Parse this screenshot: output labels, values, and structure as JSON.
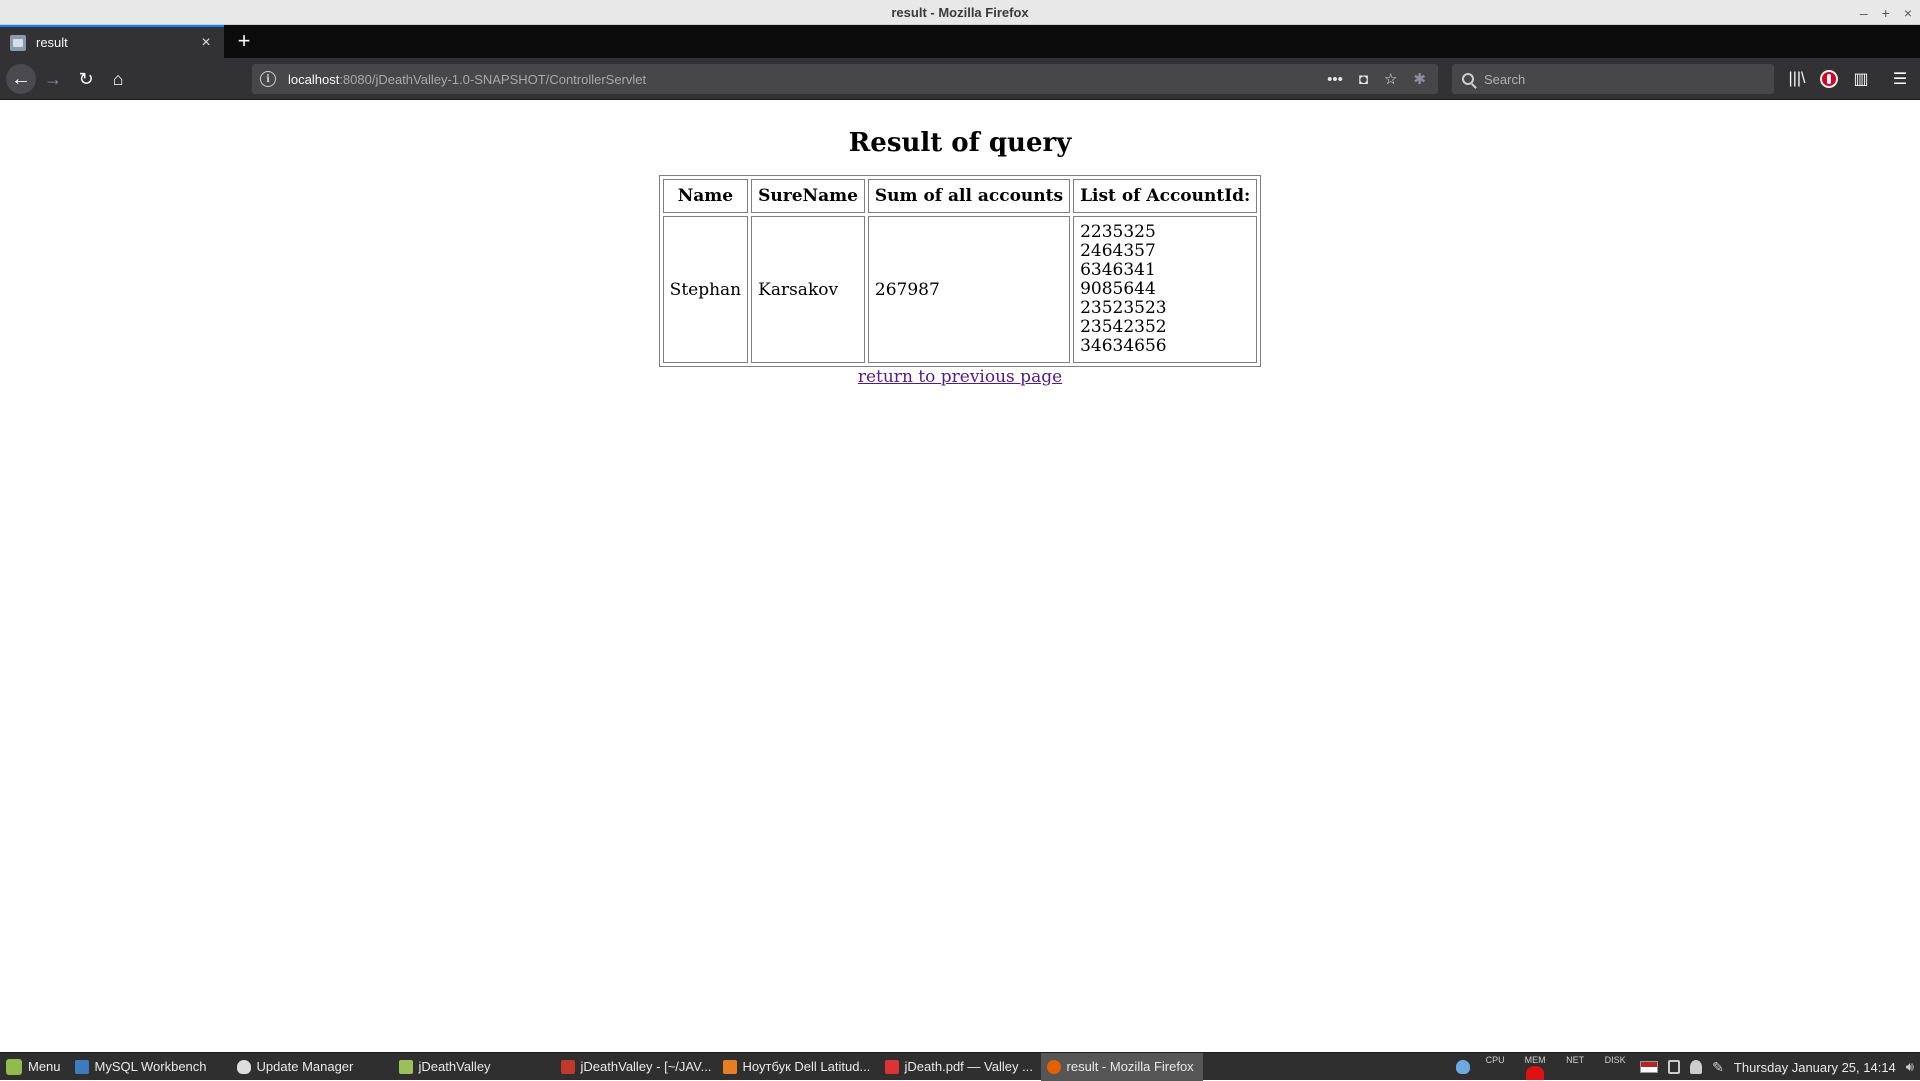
{
  "window": {
    "title": "result - Mozilla Firefox",
    "controls": [
      "–",
      "+",
      "×"
    ]
  },
  "tab": {
    "title": "result",
    "close": "×",
    "new_tab": "+"
  },
  "toolbar": {
    "back": "←",
    "forward": "→",
    "reload": "↻",
    "home": "⌂",
    "url_host": "localhost",
    "url_rest": ":8080/jDeathValley-1.0-SNAPSHOT/ControllerServlet",
    "page_actions_more": "•••",
    "pocket": "◘",
    "bookmark": "☆",
    "extension": "✱",
    "search_placeholder": "Search",
    "library": "|||\\",
    "sidebar": "▥",
    "menu": "☰"
  },
  "page": {
    "title": "Result of query",
    "table": {
      "headers": [
        "Name",
        "SureName",
        "Sum of all accounts",
        "List of AccountId:"
      ],
      "rows": [
        {
          "name": "Stephan",
          "surname": "Karsakov",
          "sum": "267987",
          "account_ids": [
            "2235325",
            "2464357",
            "6346341",
            "9085644",
            "23523523",
            "23542352",
            "34634656"
          ]
        }
      ]
    },
    "back_link": "return to previous page"
  },
  "taskbar": {
    "menu_label": "Menu",
    "tasks": [
      {
        "label": "MySQL Workbench",
        "color": "#3b7bbf"
      },
      {
        "label": "Update Manager",
        "color": "#dddddd"
      },
      {
        "label": "jDeathValley",
        "color": "#9bbf5a"
      },
      {
        "label": "jDeathValley - [~/JAV...",
        "color": "#c0392b"
      },
      {
        "label": "Ноутбук Dell Latitud...",
        "color": "#e67e22"
      },
      {
        "label": "jDeath.pdf — Valley ...",
        "color": "#d33"
      },
      {
        "label": "result - Mozilla Firefox",
        "color": "#e66000"
      }
    ],
    "tray": {
      "cpu": "CPU",
      "mem": "MEM",
      "net": "NET",
      "disk": "DISK",
      "clock": "Thursday January 25, 14:14"
    }
  }
}
